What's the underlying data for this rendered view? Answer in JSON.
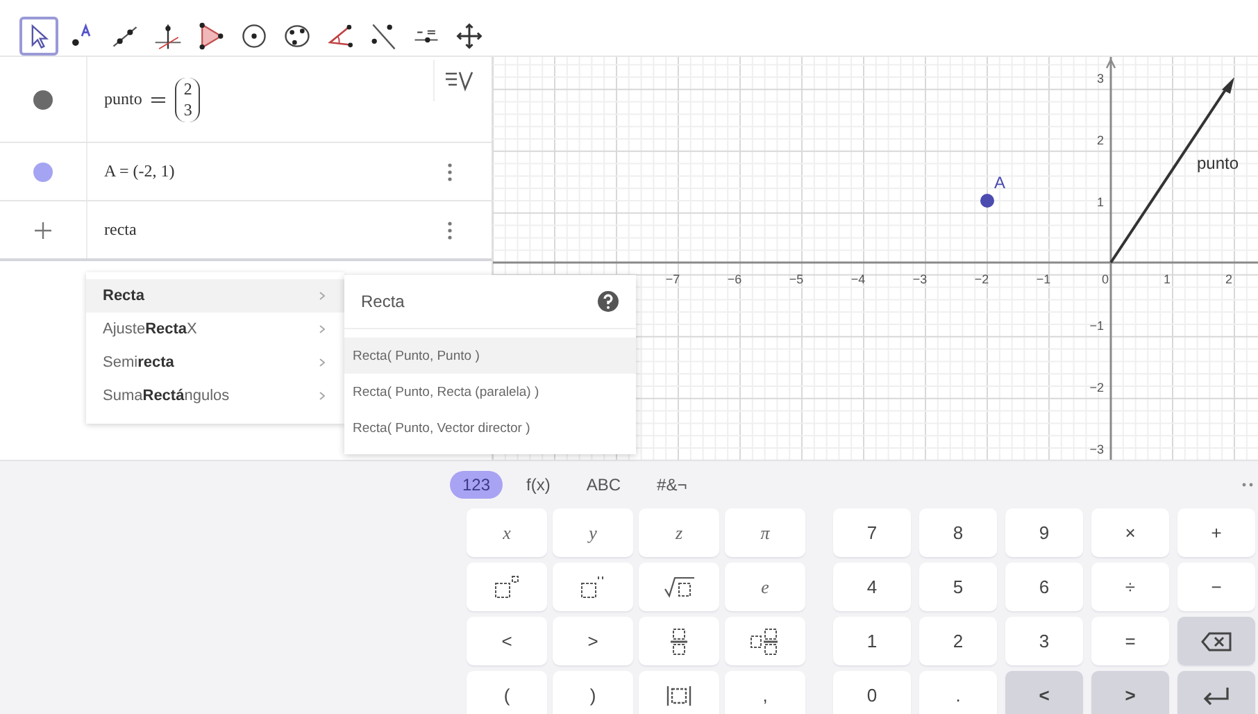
{
  "toolbar": {
    "tools": [
      {
        "kind": "move",
        "selected": true
      },
      {
        "kind": "point",
        "selected": false
      },
      {
        "kind": "segment",
        "selected": false
      },
      {
        "kind": "perpendicular",
        "selected": false
      },
      {
        "kind": "polygon",
        "selected": false
      },
      {
        "kind": "circle",
        "selected": false
      },
      {
        "kind": "conic",
        "selected": false
      },
      {
        "kind": "angle",
        "selected": false
      },
      {
        "kind": "reflect",
        "selected": false
      },
      {
        "kind": "slider",
        "selected": false
      },
      {
        "kind": "pan",
        "selected": false
      }
    ]
  },
  "algebra": {
    "items": [
      {
        "kind": "vector",
        "color": "#6a6a6a",
        "name": "punto",
        "entries": [
          "2",
          "3"
        ],
        "menu": false
      },
      {
        "kind": "text",
        "color": "#a4a4f2",
        "text": "A = (-2, 1)",
        "menu": true
      }
    ],
    "input": {
      "value": "recta",
      "menu": true
    }
  },
  "suggestions": {
    "items": [
      {
        "text": "**Recta**",
        "selected": true
      },
      {
        "text": "Ajuste**Recta**X",
        "selected": false
      },
      {
        "text": "Semi**recta**",
        "selected": false
      },
      {
        "text": "Suma**Rectá**ngulos",
        "selected": false
      }
    ]
  },
  "syntax": {
    "title": "Recta",
    "items": [
      {
        "text": "Recta( Punto, Punto )",
        "selected": true
      },
      {
        "text": "Recta( Punto, Recta (paralela) )",
        "selected": false
      },
      {
        "text": "Recta( Punto, Vector director )",
        "selected": false
      }
    ]
  },
  "graphics": {
    "x_ticks": [
      "−7",
      "−6",
      "−5",
      "−4",
      "−3",
      "−2",
      "−1",
      "0",
      "1",
      "2"
    ],
    "y_ticks": [
      "3",
      "2",
      "1",
      "−1",
      "−2",
      "−3"
    ],
    "objects": [
      {
        "kind": "point",
        "label": "A",
        "color": "#4b4bb0"
      },
      {
        "kind": "vector",
        "label": "punto",
        "color": "#333333"
      }
    ]
  },
  "keyboard": {
    "tabs": [
      {
        "label": "123",
        "selected": true
      },
      {
        "label": "f(x)",
        "selected": false
      },
      {
        "label": "ABC",
        "selected": false
      },
      {
        "label": "#&¬",
        "selected": false
      }
    ],
    "left": [
      [
        {
          "kind": "var",
          "label": "x"
        },
        {
          "kind": "var",
          "label": "y"
        },
        {
          "kind": "var",
          "label": "z"
        },
        {
          "kind": "var",
          "label": "π"
        }
      ],
      [
        {
          "kind": "square"
        },
        {
          "kind": "power"
        },
        {
          "kind": "sqrt"
        },
        {
          "kind": "var",
          "label": "e"
        }
      ],
      [
        {
          "kind": "char",
          "label": "<"
        },
        {
          "kind": "char",
          "label": ">"
        },
        {
          "kind": "fraction"
        },
        {
          "kind": "mixed"
        }
      ],
      [
        {
          "kind": "char",
          "label": "("
        },
        {
          "kind": "char",
          "label": ")"
        },
        {
          "kind": "abs"
        },
        {
          "kind": "char",
          "label": ","
        }
      ]
    ],
    "right": [
      [
        {
          "kind": "char",
          "label": "7"
        },
        {
          "kind": "char",
          "label": "8"
        },
        {
          "kind": "char",
          "label": "9"
        },
        {
          "kind": "char",
          "label": "×"
        },
        {
          "kind": "char",
          "label": "+"
        }
      ],
      [
        {
          "kind": "char",
          "label": "4"
        },
        {
          "kind": "char",
          "label": "5"
        },
        {
          "kind": "char",
          "label": "6"
        },
        {
          "kind": "char",
          "label": "÷"
        },
        {
          "kind": "char",
          "label": "−"
        }
      ],
      [
        {
          "kind": "char",
          "label": "1"
        },
        {
          "kind": "char",
          "label": "2"
        },
        {
          "kind": "char",
          "label": "3"
        },
        {
          "kind": "char",
          "label": "="
        },
        {
          "kind": "backspace"
        }
      ],
      [
        {
          "kind": "char",
          "label": "0"
        },
        {
          "kind": "char",
          "label": "."
        },
        {
          "kind": "arrow",
          "label": "<"
        },
        {
          "kind": "arrow",
          "label": ">"
        },
        {
          "kind": "enter"
        }
      ]
    ]
  }
}
